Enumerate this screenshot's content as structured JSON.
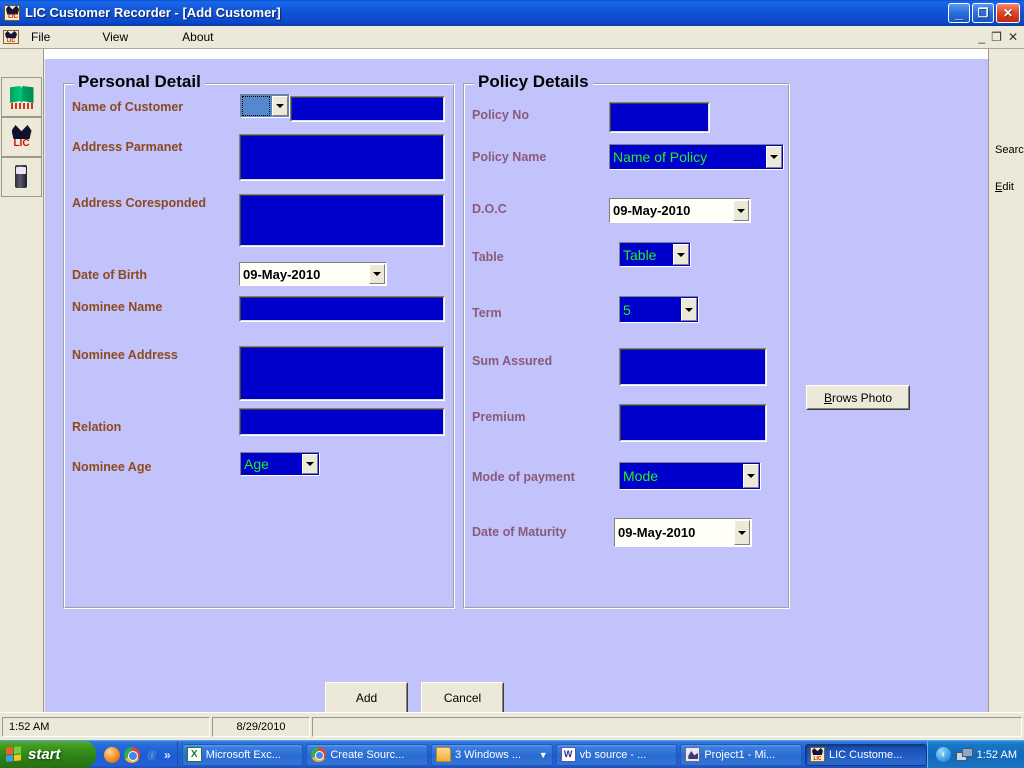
{
  "window": {
    "title": "LIC Customer Recorder  - [Add Customer]",
    "icon": "lic-app-icon",
    "minimize_label": "_",
    "restore_label": "❐",
    "close_label": "✕",
    "mdi_minimize_label": "_",
    "mdi_restore_label": "❐",
    "mdi_close_label": "✕"
  },
  "menu": {
    "items": [
      {
        "label": "File"
      },
      {
        "label": "View"
      },
      {
        "label": "About"
      }
    ]
  },
  "sidebar": {
    "buttons": [
      {
        "icon": "book-icon",
        "name": "sidebar-button-book"
      },
      {
        "icon": "lic-logo-icon",
        "name": "sidebar-button-lic"
      },
      {
        "icon": "device-icon",
        "name": "sidebar-button-device"
      }
    ]
  },
  "right_pane": {
    "search_label": "Search",
    "edit_label_prefix": "E",
    "edit_label_rest": "dit"
  },
  "personal_detail": {
    "title": "Personal Detail",
    "fields": {
      "name_of_customer": {
        "label": "Name of Customer",
        "prefix_value": "",
        "value": ""
      },
      "address_parmanet": {
        "label": "Address Parmanet",
        "value": ""
      },
      "address_coresponded": {
        "label": "Address Coresponded",
        "value": ""
      },
      "date_of_birth": {
        "label": "Date of Birth",
        "value": "09-May-2010"
      },
      "nominee_name": {
        "label": "Nominee Name",
        "value": ""
      },
      "nominee_address": {
        "label": "Nominee Address",
        "value": ""
      },
      "relation": {
        "label": "Relation",
        "value": ""
      },
      "nominee_age": {
        "label": "Nominee Age",
        "value": "Age"
      }
    }
  },
  "policy_details": {
    "title": "Policy Details",
    "fields": {
      "policy_no": {
        "label": "Policy No",
        "value": ""
      },
      "policy_name": {
        "label": "Policy Name",
        "value": "Name of Policy"
      },
      "doc": {
        "label": "D.O.C",
        "value": "09-May-2010"
      },
      "table": {
        "label": "Table",
        "value": "Table"
      },
      "term": {
        "label": "Term",
        "value": "5"
      },
      "sum_assured": {
        "label": "Sum Assured",
        "value": ""
      },
      "premium": {
        "label": "Premium",
        "value": ""
      },
      "mode_of_payment": {
        "label": "Mode of payment",
        "value": "Mode"
      },
      "date_of_maturity": {
        "label": "Date of Maturity",
        "value": "09-May-2010"
      }
    }
  },
  "photo": {
    "brows_accel": "B",
    "brows_rest": "rows Photo"
  },
  "actions": {
    "add_label": "Add",
    "cancel_label": "Cancel"
  },
  "statusbar": {
    "time": "1:52 AM",
    "date": "8/29/2010",
    "extra": ""
  },
  "taskbar": {
    "start_label": "start",
    "quicklaunch_overflow": "»",
    "quicklaunch": [
      {
        "name": "media-player-icon"
      },
      {
        "name": "chrome-icon"
      },
      {
        "name": "internet-explorer-icon",
        "glyph": "e"
      }
    ],
    "tasks": [
      {
        "label": "Microsoft Exc...",
        "icon": "excel-icon",
        "active": false,
        "has_arrow": false
      },
      {
        "label": "Create Sourc...",
        "icon": "chrome-icon",
        "active": false,
        "has_arrow": false
      },
      {
        "label": "3 Windows ...",
        "icon": "folder-icon",
        "active": false,
        "has_arrow": true,
        "arrow": "▼"
      },
      {
        "label": "vb source - ...",
        "icon": "word-icon",
        "active": false,
        "has_arrow": false
      },
      {
        "label": "Project1 - Mi...",
        "icon": "vb-project-icon",
        "active": false,
        "has_arrow": false
      },
      {
        "label": "LIC Custome...",
        "icon": "lic-app-icon",
        "active": true,
        "has_arrow": false
      }
    ],
    "tray": {
      "chevron": "‹",
      "network_icon": "network-icon",
      "clock": "1:52 AM"
    }
  },
  "colors": {
    "form_background": "#c3c3fc",
    "field_background": "#0000cc",
    "combo_text": "#22ee22",
    "label_personal": "#8c4a20",
    "label_policy": "#8a5a7a",
    "titlebar": "#1256d8",
    "chrome": "#ece9d8"
  }
}
